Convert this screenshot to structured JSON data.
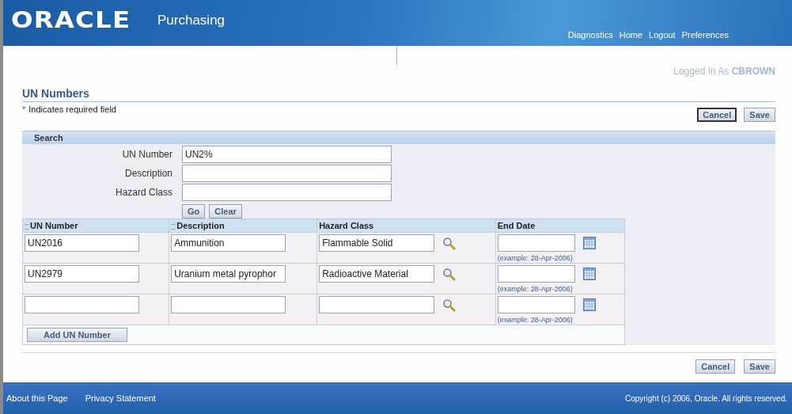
{
  "header": {
    "logo": "ORACLE",
    "app": "Purchasing",
    "links": [
      "Diagnostics",
      "Home",
      "Logout",
      "Preferences"
    ]
  },
  "user": {
    "label": "Logged In As",
    "name": "CBROWN"
  },
  "page": {
    "title": "UN Numbers",
    "required_mark": "*",
    "required_note": "Indicates required field"
  },
  "top_buttons": [
    {
      "label": "Cancel",
      "focused": true
    },
    {
      "label": "Save",
      "focused": false
    }
  ],
  "search": {
    "title": "Search",
    "fields": [
      {
        "label": "UN Number",
        "value": "UN2%"
      },
      {
        "label": "Description"
      },
      {
        "label": "Hazard Class"
      }
    ],
    "buttons": [
      "Go",
      "Clear"
    ]
  },
  "table": {
    "columns": [
      {
        "label": "UN Number",
        "required": true
      },
      {
        "label": "Description",
        "required": true
      },
      {
        "label": "Hazard Class",
        "required": false
      },
      {
        "label": "End Date",
        "required": false
      }
    ],
    "rows": [
      {
        "un_number": "UN2016",
        "description": "Ammunition",
        "hazard_class": "Flammable Solid",
        "end_date_hint": "(example: 28-Apr-2006)"
      },
      {
        "un_number": "UN2979",
        "description": "Uranium metal pyrophor",
        "hazard_class": "Radioactive Material",
        "end_date_hint": "(example: 28-Apr-2006)"
      },
      {
        "end_date_hint": "(example: 28-Apr-2006)"
      }
    ],
    "add_button": "Add UN Number"
  },
  "bottom_buttons": [
    {
      "label": "Cancel",
      "focused": false
    },
    {
      "label": "Save",
      "focused": false
    }
  ],
  "footer": {
    "links": [
      "About this Page",
      "Privacy Statement"
    ],
    "copyright": "Copyright (c) 2006, Oracle. All rights reserved."
  }
}
